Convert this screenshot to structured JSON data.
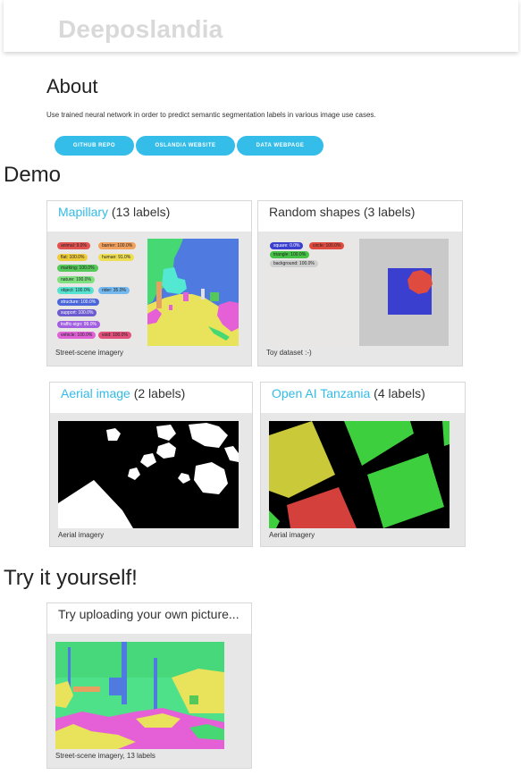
{
  "nav": {
    "brand": "Deeposlandia"
  },
  "about": {
    "heading": "About",
    "description": "Use trained neural network in order to predict semantic segmentation labels in various image use cases.",
    "buttons": [
      "Github repo",
      "Oslandia website",
      "Data webpage"
    ]
  },
  "demo": {
    "heading": "Demo",
    "cards": [
      {
        "link": "Mapillary",
        "suffix": " (13 labels)",
        "caption": "Street-scene imagery",
        "legend": [
          {
            "label": "animal: 9.0%",
            "color": "#e0514f"
          },
          {
            "label": "barrier: 100.0%",
            "color": "#f1a05d"
          },
          {
            "label": "flat: 100.0%",
            "color": "#efcc3c"
          },
          {
            "label": "human: 91.0%",
            "color": "#eede53"
          },
          {
            "label": "marking: 100.0%",
            "color": "#55c85a"
          },
          {
            "label": "nature: 100.0%",
            "color": "#7fe07f"
          },
          {
            "label": "object: 100.0%",
            "color": "#55e2d0"
          },
          {
            "label": "rider: 35.0%",
            "color": "#73b8ef"
          },
          {
            "label": "structure: 100.0%",
            "color": "#4b66d8"
          },
          {
            "label": "support: 100.0%",
            "color": "#6d5bd0"
          },
          {
            "label": "traffic-sign: 99.0%",
            "color": "#a260e0"
          },
          {
            "label": "vehicle: 100.0%",
            "color": "#e062d6"
          },
          {
            "label": "void: 100.0%",
            "color": "#e2507c"
          }
        ]
      },
      {
        "title": "Random shapes (3 labels)",
        "caption": "Toy dataset :-)",
        "legend": [
          {
            "label": "square: 0.0%",
            "color": "#3b3fd0"
          },
          {
            "label": "circle: 100.0%",
            "color": "#e04b3f"
          },
          {
            "label": "triangle: 100.0%",
            "color": "#45c245"
          },
          {
            "label": "background: 100.0%",
            "color": "#cfcfcf"
          }
        ]
      },
      {
        "link": "Aerial image",
        "suffix": " (2 labels)",
        "caption": "Aerial imagery"
      },
      {
        "link": "Open AI Tanzania",
        "suffix": " (4 labels)",
        "caption": "Aerial imagery"
      }
    ]
  },
  "try": {
    "heading": "Try it yourself!",
    "card": {
      "title": "Try uploading your own picture...",
      "caption": "Street-scene imagery, 13 labels"
    }
  },
  "colors": {
    "accent": "#34bde9",
    "link": "#33bbe7",
    "card_bg": "#e7e7e7"
  }
}
